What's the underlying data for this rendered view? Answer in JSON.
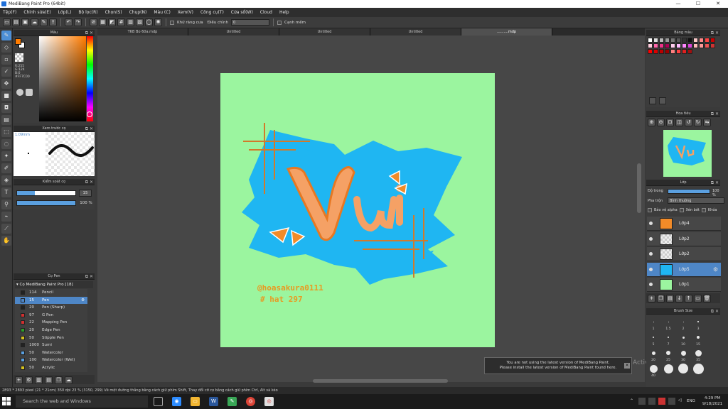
{
  "window": {
    "title": "MediBang Paint Pro (64bit)",
    "controls": [
      "—",
      "☐",
      "✕"
    ]
  },
  "menu": [
    "Tệp(F)",
    "Chỉnh sửa(E)",
    "Lớp(L)",
    "Bộ lọc(R)",
    "Chọn(S)",
    "Chụp(N)",
    "Màu (C)",
    "Xem(V)",
    "Công cụ(T)",
    "Cửa sổ(W)",
    "Cloud",
    "Help"
  ],
  "toolbar": {
    "anti_alias_label": "Khử răng cưa",
    "adjust_label": "Điều chỉnh",
    "adjust_value": "0",
    "edge_label": "Cạnh mềm"
  },
  "doc_tabs": [
    "TKB Bo 60a.mdp",
    "Untitled",
    "Untitled",
    "Untitled",
    "..........mdp"
  ],
  "panels": {
    "color": {
      "title": "Màu",
      "rgb": [
        "R:255",
        "G:124",
        "B:0"
      ],
      "hex": "#FF7C00",
      "primary": "#ff7c00",
      "secondary": "#ffffff"
    },
    "brush_preview": {
      "title": "Xem trước cọ",
      "size": "1.09mm"
    },
    "brush_control": {
      "title": "Kiểm soát cọ",
      "size_value": "15",
      "opacity_value": "100 %"
    },
    "brush_list": {
      "title": "Cọ Pen",
      "group": "Cọ MediBang Paint Pro [18]",
      "items": [
        {
          "num": "114",
          "name": "Pencil",
          "color": "#222222"
        },
        {
          "num": "15",
          "name": "Pen",
          "color": "#4e86c6"
        },
        {
          "num": "20",
          "name": "Pen (Sharp)",
          "color": "#222222"
        },
        {
          "num": "97",
          "name": "G Pen",
          "color": "#d23030"
        },
        {
          "num": "22",
          "name": "Mapping Pen",
          "color": "#d23030"
        },
        {
          "num": "20",
          "name": "Edge Pen",
          "color": "#2ca02c"
        },
        {
          "num": "50",
          "name": "Stipple Pen",
          "color": "#d6c21e"
        },
        {
          "num": "1000",
          "name": "Sumi",
          "color": "#222222"
        },
        {
          "num": "50",
          "name": "Watercolor",
          "color": "#5aa0e0"
        },
        {
          "num": "100",
          "name": "Watercolor (Wet)",
          "color": "#5aa0e0"
        },
        {
          "num": "50",
          "name": "Acrylic",
          "color": "#d6c21e"
        }
      ]
    },
    "palette": {
      "title": "Bảng màu"
    },
    "navigator": {
      "title": "Hoa tiêu"
    },
    "layers": {
      "title": "Lớp",
      "opacity_label": "Độ trong",
      "opacity_value": "100 %",
      "blend_label": "Pha trộn",
      "blend_value": "Bình thường",
      "protect_alpha": "Bảo vệ alpha",
      "clipping": "Xén bớt",
      "lock": "Khóa",
      "items": [
        "Lớp4",
        "Lớp2",
        "Lớp2",
        "Lớp5",
        "Lớp1"
      ]
    },
    "brush_size": {
      "title": "Brush Size",
      "labels": [
        "1",
        "1.5",
        "2",
        "3",
        "5",
        "7",
        "10",
        "15",
        "20",
        "25",
        "30",
        "35",
        "40"
      ]
    }
  },
  "artwork": {
    "title_text": "Vui",
    "credit": "@hoasakura0111",
    "tag": "# hat 297"
  },
  "notification": {
    "line1": "You are not using the latest version of MediBang Paint.",
    "line2": "Please install the latest version of MediBang Paint found here.",
    "watermark": "Activate Windows"
  },
  "status": "2893 * 2893 pixel  (21 * 21cm)  350 dpi  23 %  (3150, 299)  Vẽ một đường thẳng bằng cách giữ phím Shift, Thay đổi cỡ cọ bằng cách giữ phím Ctrl, Alt và kéo",
  "taskbar": {
    "search_placeholder": "Search the web and Windows",
    "lang": "ENG",
    "time": "4:29 PM",
    "date": "9/18/2021"
  }
}
